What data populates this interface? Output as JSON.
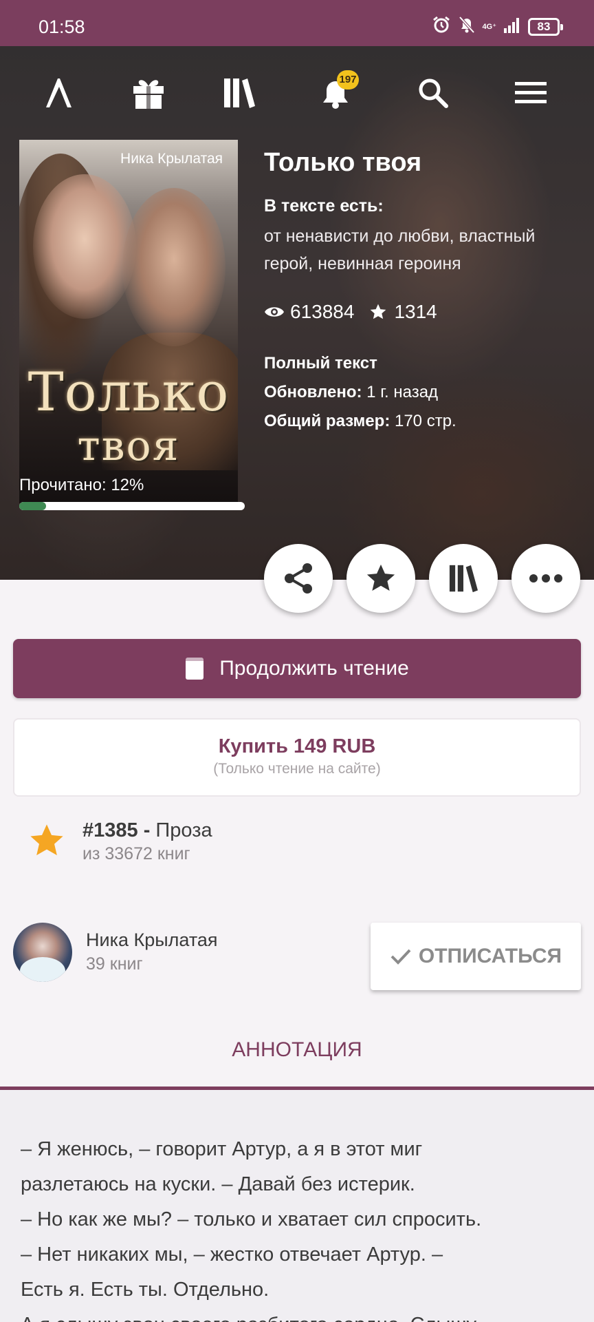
{
  "status_bar": {
    "time": "01:58",
    "network": "4G⁺",
    "battery": "83"
  },
  "top_nav": {
    "notifications_badge": "197"
  },
  "book": {
    "cover_author": "Ника Крылатая",
    "cover_title_line1": "Только",
    "cover_title_line2": "твоя",
    "title": "Только твоя",
    "tags_heading": "В тексте есть:",
    "tags": "от ненависти до любви, властный герой, невинная героиня",
    "views": "613884",
    "likes": "1314",
    "status": "Полный текст",
    "updated_label": "Обновлено:",
    "updated_value": " 1 г. назад",
    "size_label": "Общий размер:",
    "size_value": " 170 стр."
  },
  "progress": {
    "label": "Прочитано: 12%",
    "fraction": 0.12
  },
  "actions": {
    "continue_label": "Продолжить чтение",
    "buy_label": "Купить 149 RUB",
    "buy_note": "(Только чтение на сайте)"
  },
  "rank": {
    "position": "#1385 -",
    "genre": " Проза",
    "total": "из 33672 книг"
  },
  "author": {
    "name": "Ника Крылатая",
    "books": "39 книг",
    "unsubscribe_label": "ОТПИСАТЬСЯ"
  },
  "annotation": {
    "tab_label": "АННОТАЦИЯ",
    "line1": "– Я женюсь, – говорит Артур, а я в этот миг",
    "line2": "разлетаюсь на куски. – Давай без истерик.",
    "line3": "– Но как же мы? – только и хватает сил спросить.",
    "line4": "– Нет никаких мы, – жестко отвечает Артур. –",
    "line5": "Есть я. Есть ты. Отдельно.",
    "line6": "А я слышу звон своего разбитого сердца. Слышу"
  },
  "colors": {
    "brand": "#7d3d5e",
    "status_bar": "#7b3e5e",
    "badge": "#f2c21d",
    "progress": "#3f8a53",
    "rank_star": "#f5a623"
  }
}
